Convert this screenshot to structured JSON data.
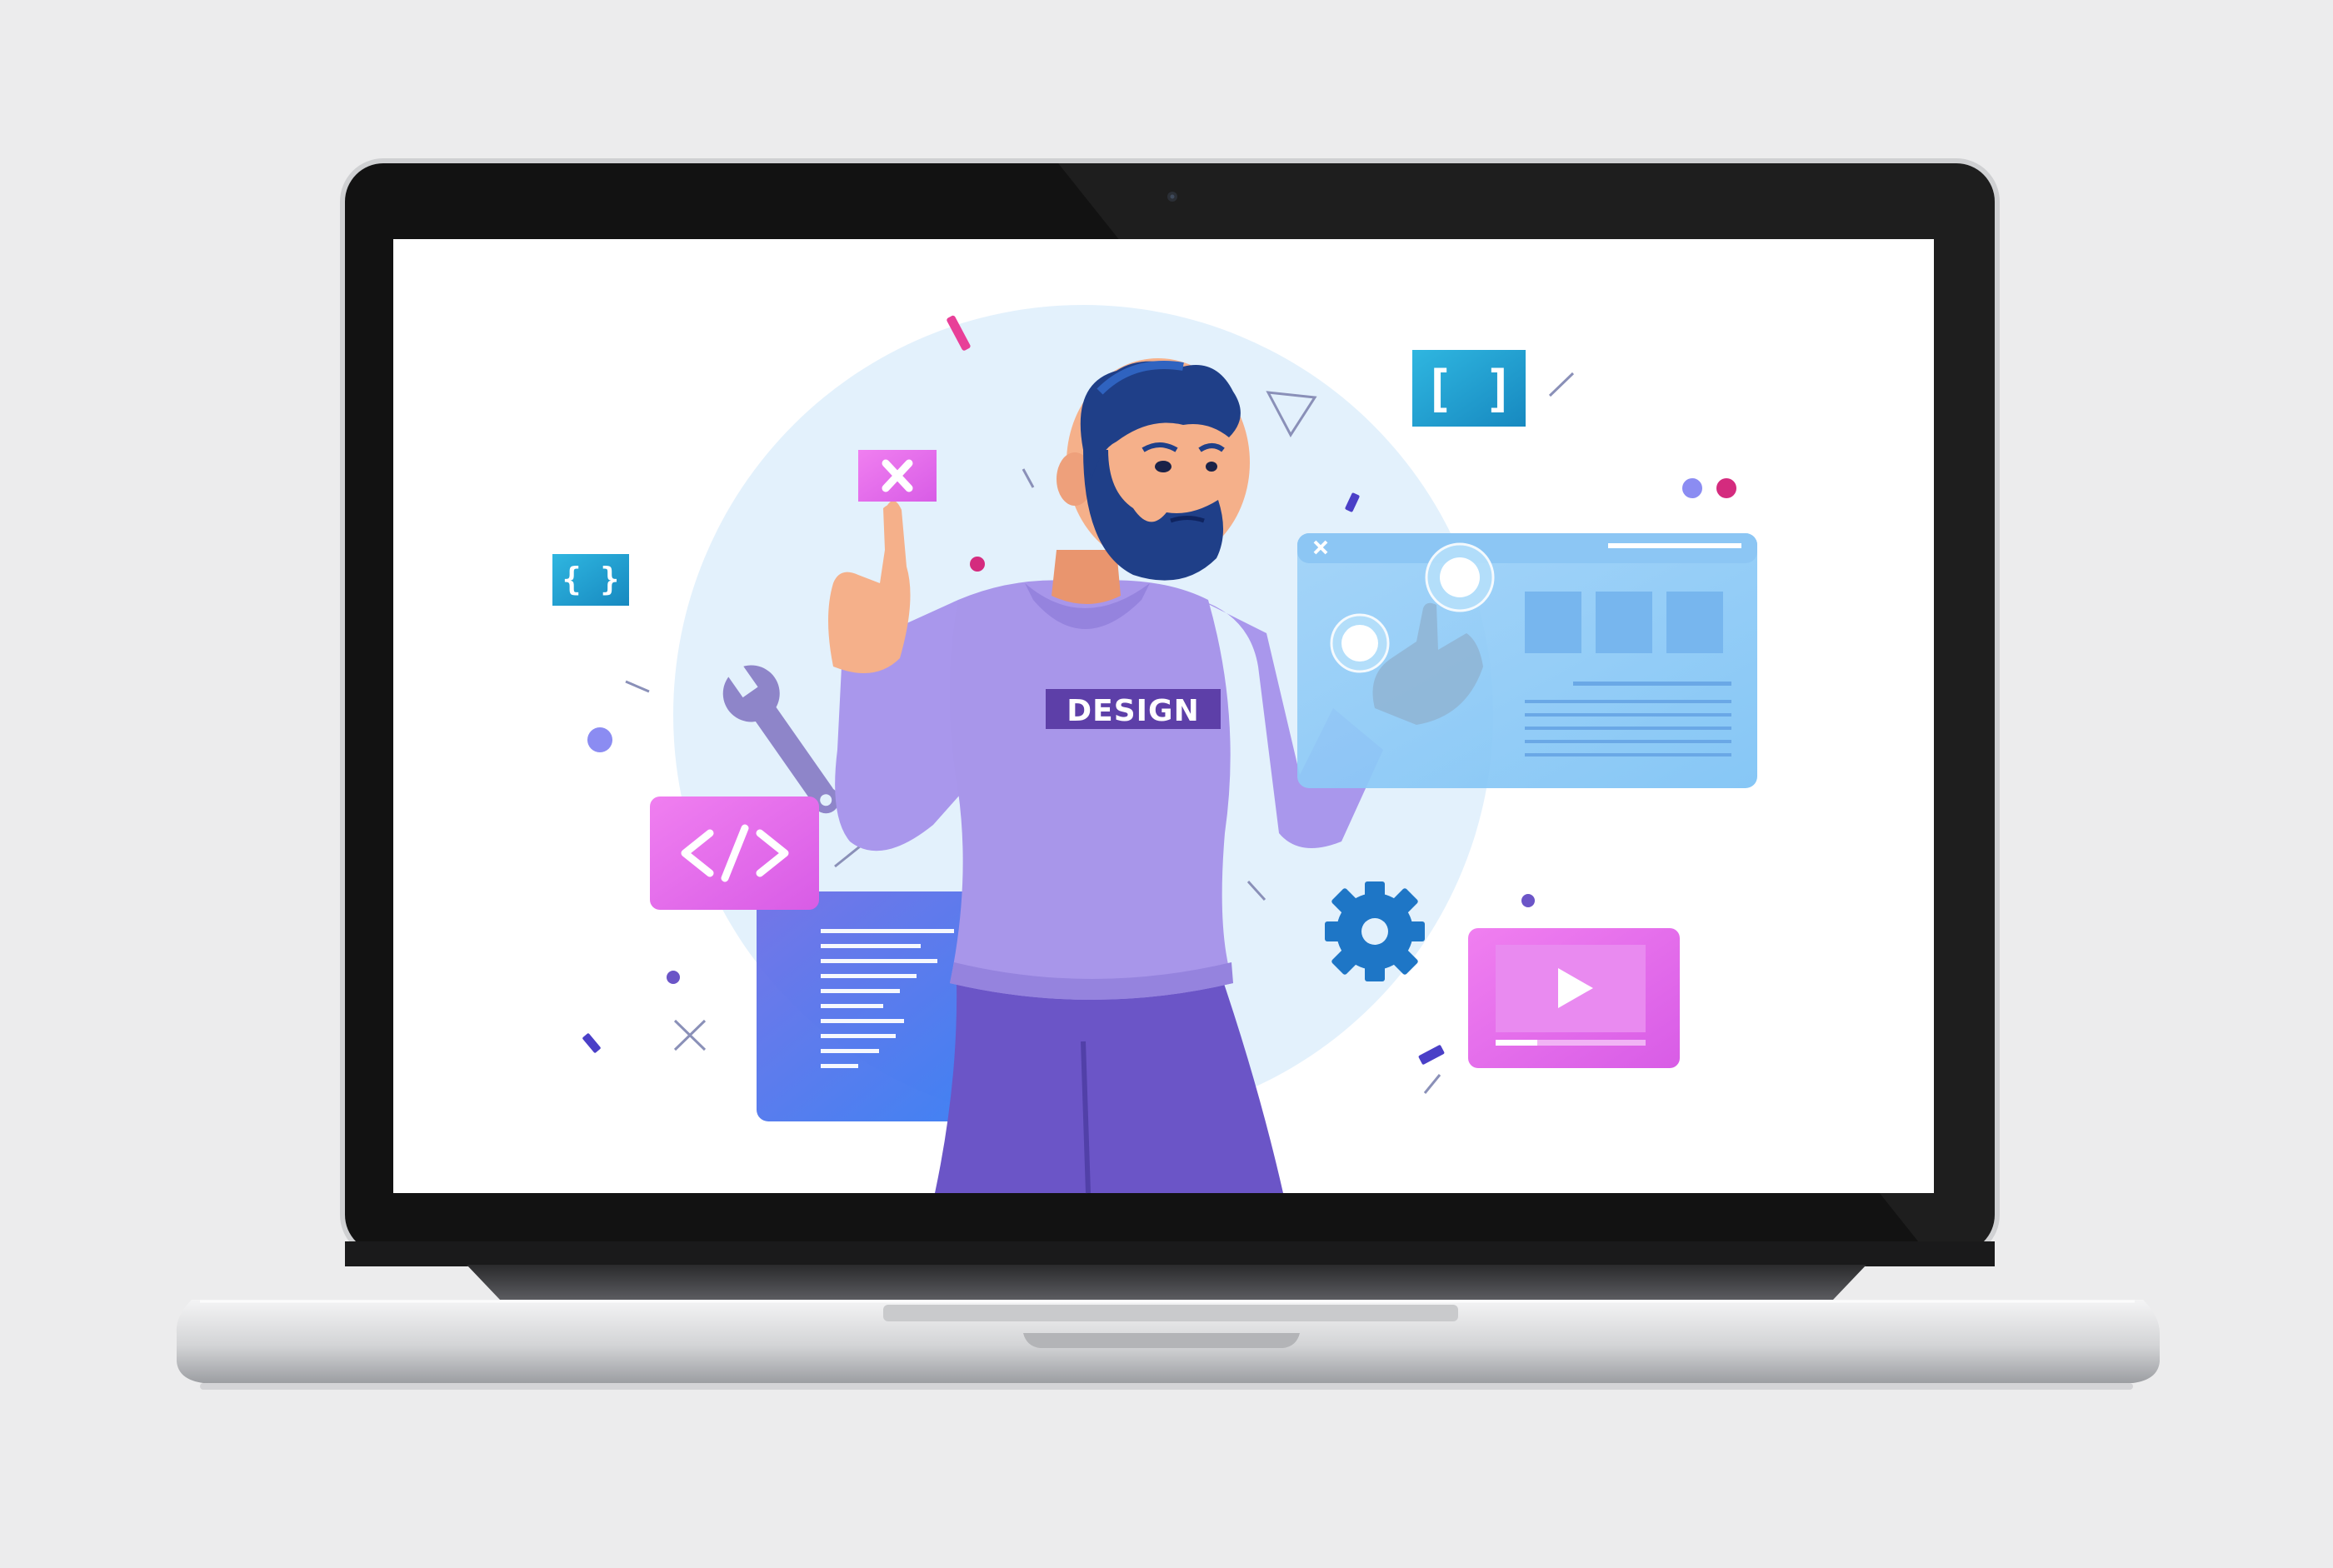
{
  "device": {
    "type": "laptop",
    "bezel_color": "#121212",
    "body_color": "#d6d7d9",
    "camera": "webcam-icon"
  },
  "screen": {
    "background": "#ffffff",
    "illustration": {
      "shirt_text": "DESIGN",
      "icons": [
        "close-icon",
        "code-icon",
        "curly-braces-icon",
        "square-brackets-icon",
        "wrench-icon",
        "gear-icon",
        "play-icon",
        "browser-window-icon",
        "code-panel-icon"
      ],
      "colors": {
        "accent_pink": "#e36fe8",
        "accent_blue": "#3d8cf5",
        "accent_cyan": "#1ea3d0",
        "shirt": "#a896ea",
        "pants": "#6b55c7",
        "backdrop_circle": "#e3f1fc"
      }
    }
  }
}
